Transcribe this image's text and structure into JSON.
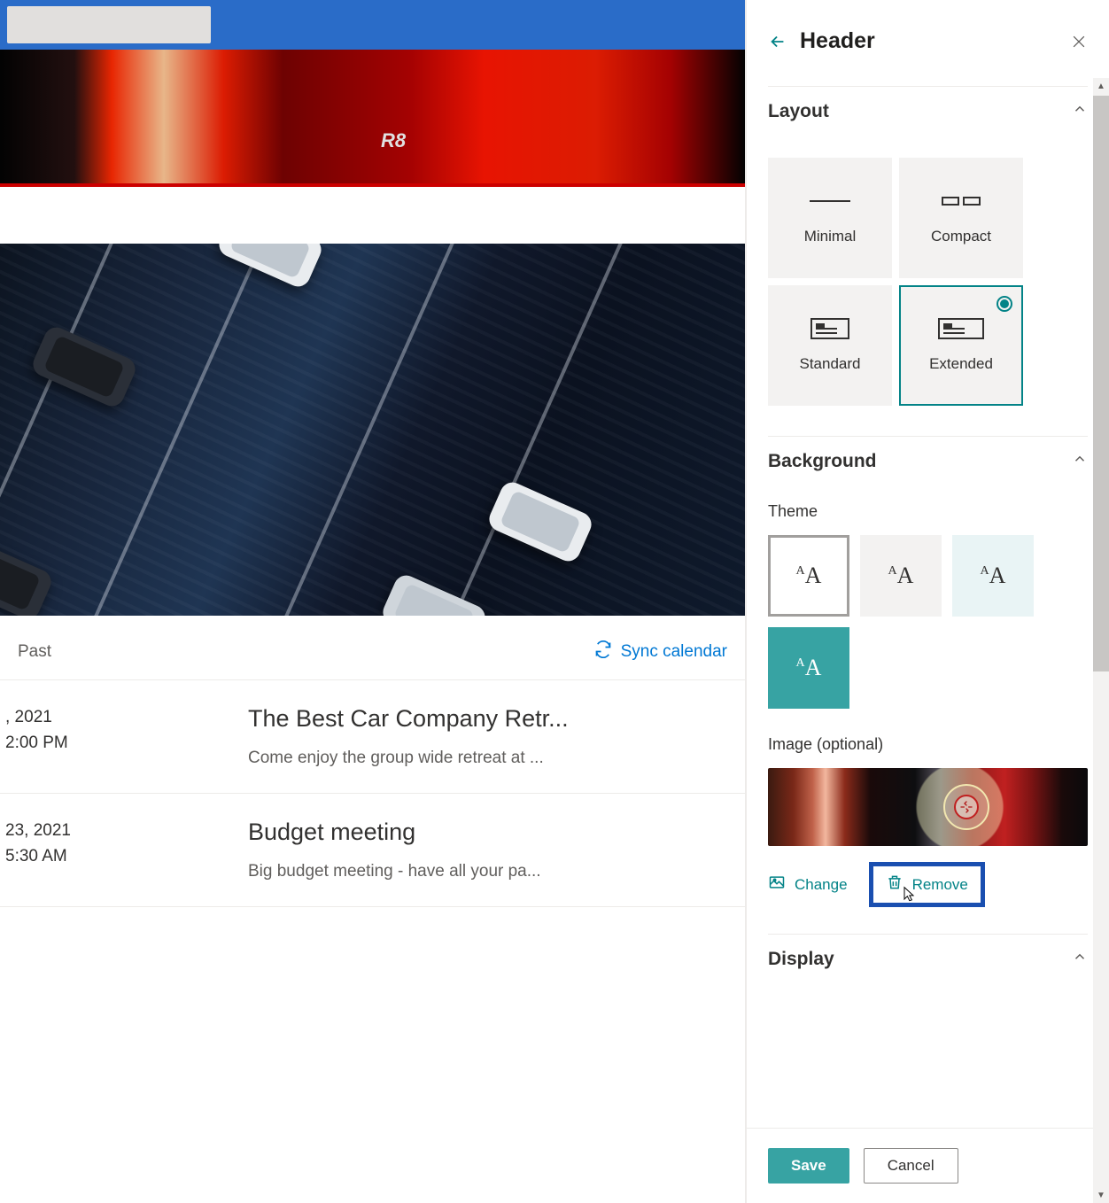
{
  "header_image": {
    "badge_text": "R8"
  },
  "toolbar": {
    "past_label": "Past",
    "sync_label": "Sync calendar"
  },
  "events": [
    {
      "date_line1": ", 2021",
      "date_line2": "2:00 PM",
      "title": "The Best Car Company Retr...",
      "desc": "Come enjoy the group wide retreat at ..."
    },
    {
      "date_line1": "23, 2021",
      "date_line2": "5:30 AM",
      "title": "Budget meeting",
      "desc": "Big budget meeting - have all your pa..."
    }
  ],
  "panel": {
    "title": "Header",
    "sections": {
      "layout": "Layout",
      "background": "Background",
      "display": "Display"
    },
    "layout_options": {
      "minimal": "Minimal",
      "compact": "Compact",
      "standard": "Standard",
      "extended": "Extended",
      "selected": "extended"
    },
    "theme_label": "Theme",
    "image_label": "Image (optional)",
    "actions": {
      "change": "Change",
      "remove": "Remove"
    },
    "footer": {
      "save": "Save",
      "cancel": "Cancel"
    }
  }
}
